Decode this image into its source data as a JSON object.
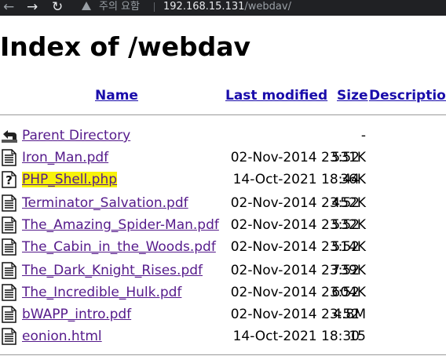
{
  "browser": {
    "warning_text": "주의 요함",
    "url_host": "192.168.15.131",
    "url_path": "/webdav/"
  },
  "page": {
    "title": "Index of /webdav",
    "columns": {
      "name": "Name",
      "last_modified": "Last modified",
      "size": "Size",
      "description": "Description"
    },
    "rows": [
      {
        "icon": "back-icon",
        "name": "Parent Directory",
        "date": "",
        "size": "-"
      },
      {
        "icon": "document-icon",
        "name": "Iron_Man.pdf",
        "date": "02-Nov-2014 23:52",
        "size": "531K"
      },
      {
        "icon": "unknown-file-icon",
        "name": "PHP_Shell.php",
        "date": "14-Oct-2021 18:44",
        "size": "36K",
        "highlight": true
      },
      {
        "icon": "document-icon",
        "name": "Terminator_Salvation.pdf",
        "date": "02-Nov-2014 23:52",
        "size": "452K"
      },
      {
        "icon": "document-icon",
        "name": "The_Amazing_Spider-Man.pdf",
        "date": "02-Nov-2014 23:52",
        "size": "532K"
      },
      {
        "icon": "document-icon",
        "name": "The_Cabin_in_the_Woods.pdf",
        "date": "02-Nov-2014 23:52",
        "size": "514K"
      },
      {
        "icon": "document-icon",
        "name": "The_Dark_Knight_Rises.pdf",
        "date": "02-Nov-2014 23:52",
        "size": "739K"
      },
      {
        "icon": "document-icon",
        "name": "The_Incredible_Hulk.pdf",
        "date": "02-Nov-2014 23:52",
        "size": "604K"
      },
      {
        "icon": "document-icon",
        "name": "bWAPP_intro.pdf",
        "date": "02-Nov-2014 23:52",
        "size": "4.8M"
      },
      {
        "icon": "document-icon",
        "name": "eonion.html",
        "date": "14-Oct-2021 18:30",
        "size": "15"
      }
    ]
  }
}
